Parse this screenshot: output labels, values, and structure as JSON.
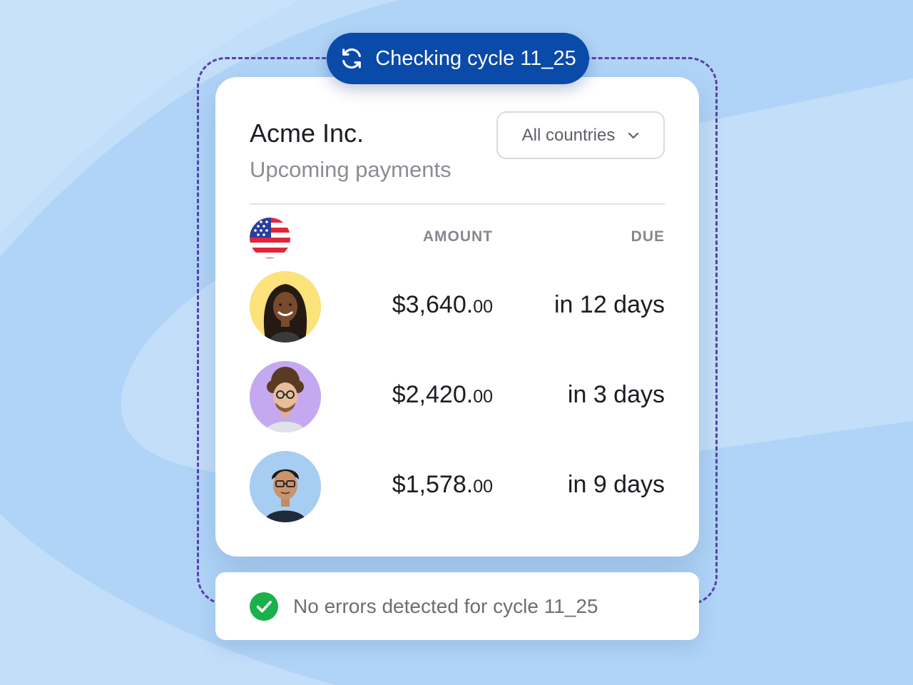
{
  "cycle_badge": {
    "label": "Checking cycle 11_25",
    "icon": "refresh-icon"
  },
  "card": {
    "company": "Acme Inc.",
    "subtitle": "Upcoming payments",
    "country_filter": {
      "selected": "All countries",
      "icon": "chevron-down-icon"
    },
    "flag": "us-flag-icon",
    "columns": {
      "amount": "AMOUNT",
      "due": "DUE"
    },
    "payments": [
      {
        "avatar": "avatar-woman",
        "amount_main": "$3,640.",
        "amount_cents": "00",
        "due": "in 12 days",
        "avatar_bg": "#fbe27a"
      },
      {
        "avatar": "avatar-man-glasses-curly",
        "amount_main": "$2,420.",
        "amount_cents": "00",
        "due": "in 3 days",
        "avatar_bg": "#c4a9f0"
      },
      {
        "avatar": "avatar-man-glasses",
        "amount_main": "$1,578.",
        "amount_cents": "00",
        "due": "in 9 days",
        "avatar_bg": "#a7cdf3"
      }
    ]
  },
  "status": {
    "text": "No errors detected for cycle 11_25",
    "icon": "check-circle-icon"
  },
  "colors": {
    "accent_blue": "#0a4aa8",
    "dashed_border": "#5b3fb0",
    "success_green": "#1bb14a",
    "background": "#c3def9"
  }
}
